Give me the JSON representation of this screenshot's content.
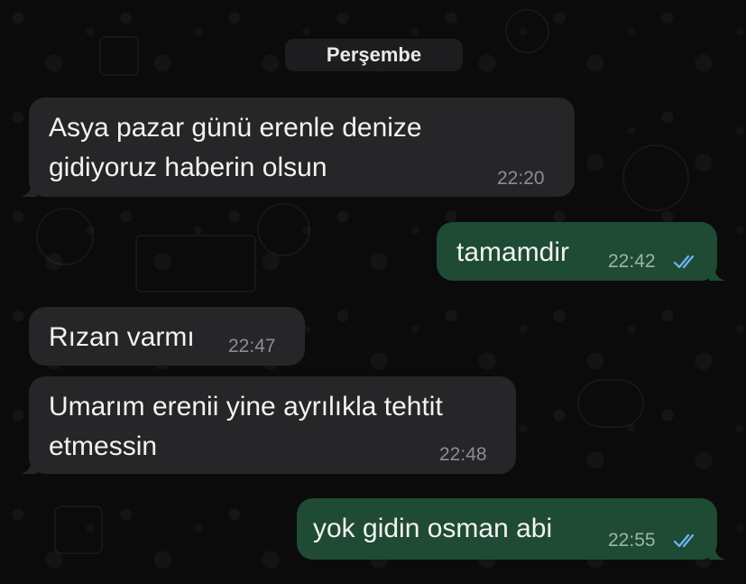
{
  "chat": {
    "date_label": "Perşembe",
    "messages": [
      {
        "direction": "incoming",
        "lines": [
          "Asya pazar günü erenle denize",
          "gidiyoruz haberin olsun"
        ],
        "time": "22:20"
      },
      {
        "direction": "outgoing",
        "lines": [
          "tamamdir"
        ],
        "time": "22:42",
        "status": "read"
      },
      {
        "direction": "incoming",
        "lines": [
          "Rızan varmı"
        ],
        "time": "22:47"
      },
      {
        "direction": "incoming",
        "lines": [
          "Umarım erenii yine ayrılıkla tehtit",
          "etmessin"
        ],
        "time": "22:48"
      },
      {
        "direction": "outgoing",
        "lines": [
          "yok gidin osman abi"
        ],
        "time": "22:55",
        "status": "read"
      }
    ]
  },
  "colors": {
    "background": "#0b0b0b",
    "incoming_bubble": "#262628",
    "outgoing_bubble": "#1f4a34",
    "read_ticks": "#6cb6f5"
  },
  "icons": {
    "read_status": "double-check-icon"
  }
}
